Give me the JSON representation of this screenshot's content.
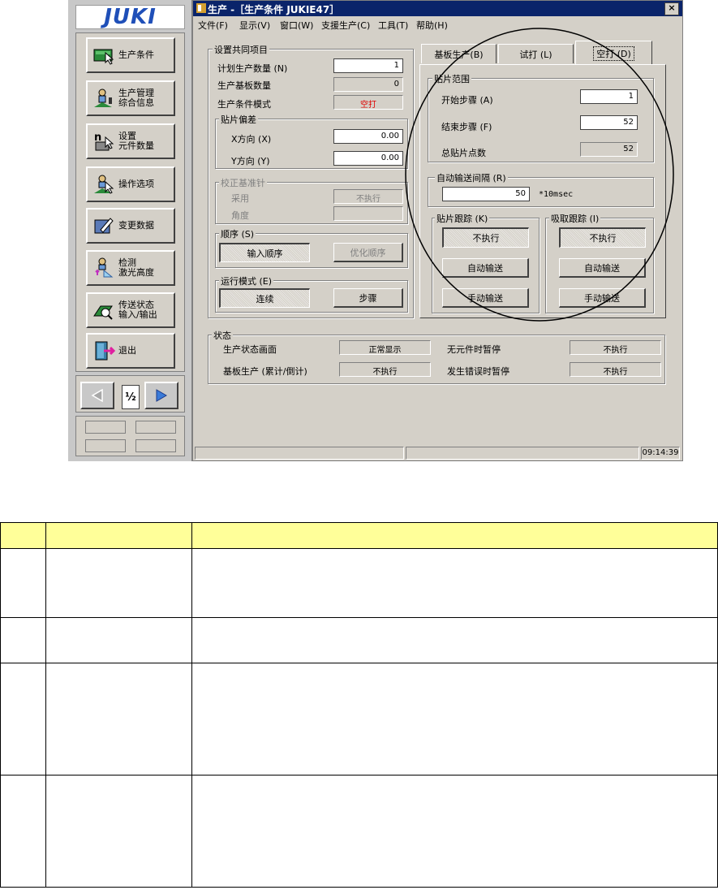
{
  "sidebar": {
    "logo": "JUKI",
    "buttons": [
      {
        "label": "生产条件",
        "icon": "production-condition-icon"
      },
      {
        "label": "生产管理\n综合信息",
        "icon": "production-management-icon"
      },
      {
        "label": "设置\n元件数量",
        "icon": "component-count-icon"
      },
      {
        "label": "操作选项",
        "icon": "operation-options-icon"
      },
      {
        "label": "变更数据",
        "icon": "change-data-icon"
      },
      {
        "label": "检测\n激光高度",
        "icon": "laser-height-icon"
      },
      {
        "label": "传送状态\n输入/输出",
        "icon": "transfer-status-icon"
      },
      {
        "label": "退出",
        "icon": "exit-icon"
      }
    ],
    "page_indicator": "½"
  },
  "window": {
    "title": "生产 -［生产条件 JUKIE47］",
    "close": "×",
    "menu": [
      "文件(F)",
      "显示(V)",
      "窗口(W)",
      "支援生产(C)",
      "工具(T)",
      "帮助(H)"
    ]
  },
  "common": {
    "title": "设置共同项目",
    "plan_qty_label": "计划生产数量 (N)",
    "plan_qty": "1",
    "board_qty_label": "生产基板数量",
    "board_qty": "0",
    "mode_label": "生产条件模式",
    "mode_value": "空打",
    "mode_color": "#e00000",
    "offset_title": "贴片偏差",
    "x_label": "X方向 (X)",
    "x_value": "0.00",
    "y_label": "Y方向 (Y)",
    "y_value": "0.00",
    "fiducial_title": "校正基准针",
    "use_label": "采用",
    "use_value": "不执行",
    "angle_label": "角度",
    "order_title": "顺序 (S)",
    "order_btn1": "输入顺序",
    "order_btn2": "优化顺序",
    "runmode_title": "运行模式 (E)",
    "run_btn1": "连续",
    "run_btn2": "步骤"
  },
  "tabs": [
    "基板生产(B)",
    "试打 (L)",
    "空打 (D)"
  ],
  "range": {
    "title": "贴片范围",
    "start_label": "开始步骤 (A)",
    "start_value": "1",
    "end_label": "结束步骤 (F)",
    "end_value": "52",
    "total_label": "总贴片点数",
    "total_value": "52"
  },
  "interval": {
    "title": "自动输送间隔 (R)",
    "value": "50",
    "unit": "*10msec"
  },
  "mount_track": {
    "title": "贴片跟踪 (K)",
    "state": "不执行",
    "auto": "自动输送",
    "manual": "手动输送"
  },
  "pick_track": {
    "title": "吸取跟踪 (I)",
    "state": "不执行",
    "auto": "自动输送",
    "manual": "手动输送"
  },
  "status": {
    "title": "状态",
    "screen_label": "生产状态画面",
    "screen_value": "正常显示",
    "board_label": "基板生产 (累计/倒计)",
    "board_value": "不执行",
    "nocomp_label": "无元件时暂停",
    "nocomp_value": "不执行",
    "error_label": "发生错误时暂停",
    "error_value": "不执行"
  },
  "statusbar": {
    "time": "09:14:39"
  },
  "table": {
    "header_color": "#ffff99"
  }
}
